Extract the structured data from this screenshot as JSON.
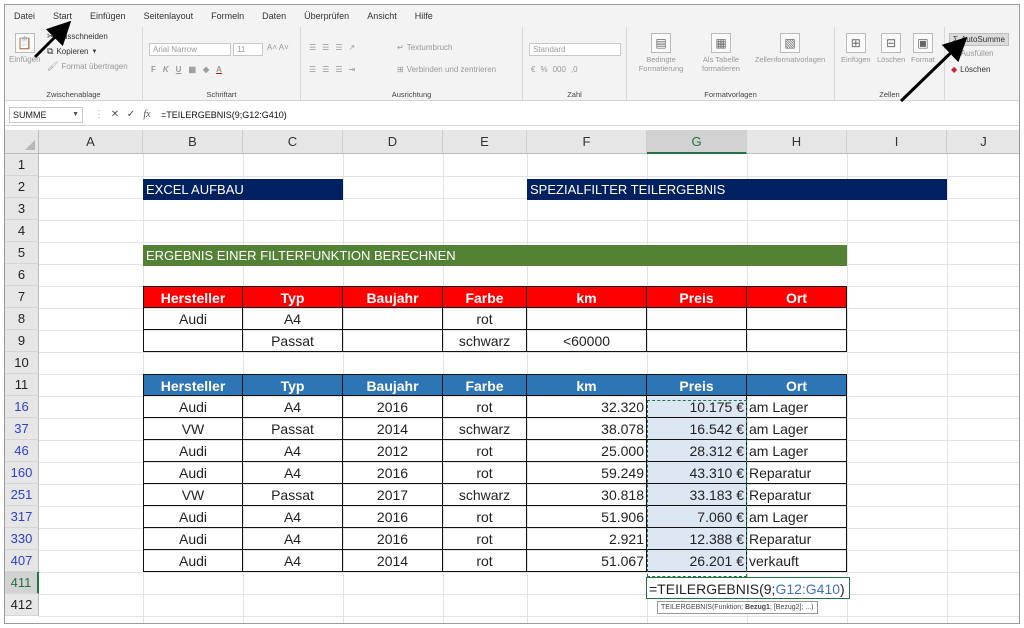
{
  "menu": [
    "Datei",
    "Start",
    "Einfügen",
    "Seitenlayout",
    "Formeln",
    "Daten",
    "Überprüfen",
    "Ansicht",
    "Hilfe"
  ],
  "ribbon": {
    "clipboard": {
      "paste": "Einfügen",
      "cut": "Ausschneiden",
      "copy": "Kopieren",
      "format_painter": "Format übertragen",
      "label": "Zwischenablage"
    },
    "font": {
      "font_name": "Arial Narrow",
      "font_size": "11",
      "label": "Schriftart"
    },
    "alignment": {
      "wrap_text": "Textumbruch",
      "merge": "Verbinden und zentrieren",
      "label": "Ausrichtung"
    },
    "number": {
      "format": "Standard",
      "label": "Zahl"
    },
    "styles": {
      "conditional": "Bedingte Formatierung",
      "as_table": "Als Tabelle formatieren",
      "cell_styles": "Zellenformatvorlagen",
      "label": "Formatvorlagen"
    },
    "cells": {
      "insert": "Einfügen",
      "delete": "Löschen",
      "format": "Format",
      "label": "Zellen"
    },
    "editing": {
      "autosum": "AutoSumme",
      "fill": "Ausfüllen",
      "clear": "Löschen"
    }
  },
  "formula_bar": {
    "name_box": "SUMME",
    "formula": "=TEILERGEBNIS(9;G12:G410)"
  },
  "columns": [
    "A",
    "B",
    "C",
    "D",
    "E",
    "F",
    "G",
    "H",
    "I",
    "J"
  ],
  "rows": [
    "1",
    "2",
    "3",
    "4",
    "5",
    "6",
    "7",
    "8",
    "9",
    "10",
    "11",
    "16",
    "37",
    "46",
    "160",
    "251",
    "317",
    "330",
    "407",
    "411",
    "412"
  ],
  "titles": {
    "excel_aufbau": "EXCEL AUFBAU",
    "spezialfilter": "SPEZIALFILTER TEILERGEBNIS",
    "ergebnis": "ERGEBNIS EINER FILTERFUNKTION BERECHNEN"
  },
  "criteria": {
    "headers": [
      "Hersteller",
      "Typ",
      "Baujahr",
      "Farbe",
      "km",
      "Preis",
      "Ort"
    ],
    "rows": [
      [
        "Audi",
        "A4",
        "",
        "rot",
        "",
        "",
        ""
      ],
      [
        "",
        "Passat",
        "",
        "schwarz",
        "<60000",
        "",
        ""
      ]
    ]
  },
  "results": {
    "headers": [
      "Hersteller",
      "Typ",
      "Baujahr",
      "Farbe",
      "km",
      "Preis",
      "Ort"
    ],
    "rows": [
      [
        "Audi",
        "A4",
        "2016",
        "rot",
        "32.320",
        "10.175 €",
        "am Lager"
      ],
      [
        "VW",
        "Passat",
        "2014",
        "schwarz",
        "38.078",
        "16.542 €",
        "am Lager"
      ],
      [
        "Audi",
        "A4",
        "2012",
        "rot",
        "25.000",
        "28.312 €",
        "am Lager"
      ],
      [
        "Audi",
        "A4",
        "2016",
        "rot",
        "59.249",
        "43.310 €",
        "Reparatur"
      ],
      [
        "VW",
        "Passat",
        "2017",
        "schwarz",
        "30.818",
        "33.183 €",
        "Reparatur"
      ],
      [
        "Audi",
        "A4",
        "2016",
        "rot",
        "51.906",
        "7.060 €",
        "am Lager"
      ],
      [
        "Audi",
        "A4",
        "2016",
        "rot",
        "2.921",
        "12.388 €",
        "Reparatur"
      ],
      [
        "Audi",
        "A4",
        "2014",
        "rot",
        "51.067",
        "26.201 €",
        "verkauft"
      ]
    ]
  },
  "edit_cell": {
    "prefix": "=TEILERGEBNIS(9;",
    "ref": "G12:G410",
    "suffix": ")"
  },
  "tooltip": {
    "prefix": "TEILERGEBNIS(Funktion; ",
    "arg": "Bezug1",
    "suffix": "; [Bezug2]; ...)"
  },
  "colors": {
    "navy": "#002060",
    "green": "#548235",
    "red": "#ff0000",
    "blue": "#2e75b6",
    "selection": "#dde6f3",
    "excel_green": "#217346"
  }
}
